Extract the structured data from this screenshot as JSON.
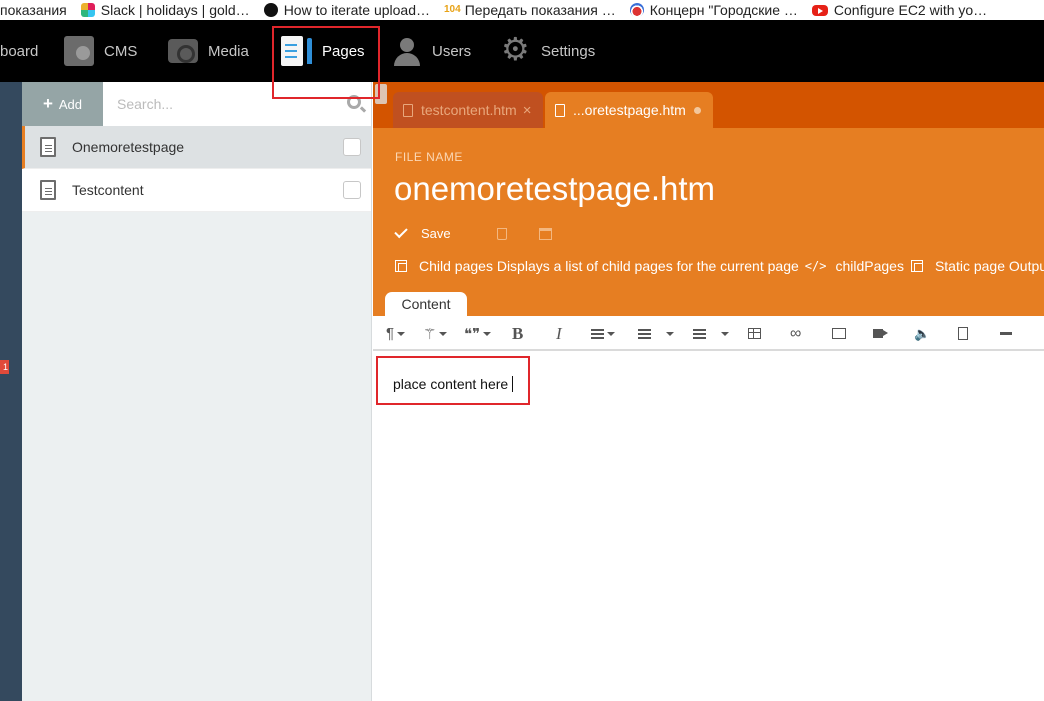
{
  "bookmarks": [
    {
      "icon": "none",
      "label": "показания"
    },
    {
      "icon": "slack-icon",
      "label": "Slack | holidays | gold…"
    },
    {
      "icon": "github-icon",
      "label": "How to iterate upload…"
    },
    {
      "icon": "104-icon",
      "icon_text": "104",
      "label": "Передать показания …"
    },
    {
      "icon": "konczern-icon",
      "label": "Концерн \"Городские …"
    },
    {
      "icon": "youtube-icon",
      "label": "Configure EC2 with yo…"
    }
  ],
  "topnav": {
    "items": [
      {
        "label": "board",
        "icon": "dashboard-icon"
      },
      {
        "label": "CMS",
        "icon": "cms-icon"
      },
      {
        "label": "Media",
        "icon": "media-icon"
      },
      {
        "label": "Pages",
        "icon": "pages-icon",
        "active": true
      },
      {
        "label": "Users",
        "icon": "users-icon"
      },
      {
        "label": "Settings",
        "icon": "settings-icon"
      }
    ]
  },
  "left_badge": "1",
  "sidebar": {
    "add_label": "Add",
    "search_placeholder": "Search...",
    "pages": [
      {
        "label": "Onemoretestpage",
        "selected": true
      },
      {
        "label": "Testcontent",
        "selected": false
      }
    ]
  },
  "tabs": [
    {
      "label": "testcontent.htm",
      "active": false
    },
    {
      "label": "...oretestpage.htm",
      "active": true
    }
  ],
  "header": {
    "file_name_label": "FILE NAME",
    "file_name": "onemoretestpage.htm",
    "save_label": "Save",
    "snippets": {
      "first_title": "Child pages",
      "first_desc": "Displays a list of child pages for the current page",
      "code_glyph": "</>",
      "first_code": "childPages",
      "second_title": "Static page Output"
    },
    "content_tab": "Content"
  },
  "toolbar": {
    "paragraph": "¶",
    "magic": "⚚",
    "quote": "❝❞",
    "bold": "B",
    "italic": "I",
    "audio": "🔈"
  },
  "editor": {
    "text": "place content here"
  },
  "colors": {
    "accent": "#e67e22",
    "accent_dark": "#d35400",
    "nav_bg": "#000000",
    "sidebar_bg": "#ecf0f1",
    "highlight": "#e0262b"
  }
}
